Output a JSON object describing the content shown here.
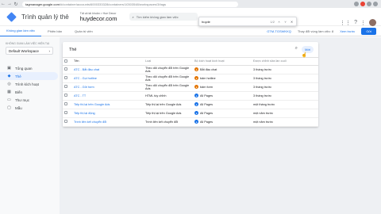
{
  "browser": {
    "host": "tagmanager.google.com",
    "url_rest": "/#/container/accounts/6000333328/containers/10303548/workspaces/3/tags",
    "back": "←",
    "forward": "→",
    "reload": "↻"
  },
  "header": {
    "app_title": "Trình quản lý thẻ",
    "account_small": "Tất cả tài khoản > Hue Decor",
    "container_name": "huydecor.com",
    "search_placeholder": "Tìm kiếm không gian làm việc"
  },
  "find_bar": {
    "query": "huyde",
    "count": "1/2",
    "up": "˄",
    "down": "˅",
    "close": "✕"
  },
  "subnav": {
    "tabs": [
      "Không gian làm việc",
      "Phiên bản",
      "Quản trị viên"
    ],
    "gtm_id": "GTM-TGSWKKQ",
    "changes": "Thay đổi vùng làm việc: 8",
    "preview": "Xem trước",
    "submit": "Gửi"
  },
  "sidebar": {
    "workspace_label": "KHÔNG GIAN LÀM VIỆC HIỆN TẠI",
    "workspace_name": "Default Workspace",
    "items": [
      {
        "label": "Tổng quan",
        "icon": "overview-icon"
      },
      {
        "label": "Thẻ",
        "icon": "tag-icon"
      },
      {
        "label": "Trình kích hoạt",
        "icon": "trigger-icon"
      },
      {
        "label": "Biến",
        "icon": "variable-icon"
      },
      {
        "label": "Thư mục",
        "icon": "folder-icon"
      },
      {
        "label": "Mẫu",
        "icon": "template-icon"
      }
    ],
    "active_index": 1
  },
  "tags_card": {
    "title": "Thẻ",
    "new_label": "Mới",
    "columns": [
      "Tên",
      "Loại",
      "Bộ kích hoạt kích hoạt",
      "Được chỉnh sửa lần cuối"
    ],
    "rows": [
      {
        "name": "ATC - Bắt đầu chat",
        "type": "Theo dõi chuyển đổi trên Google Ads",
        "trigger": "Bắt đầu chat",
        "trigger_color": "orange",
        "time": "3 tháng trước"
      },
      {
        "name": "ATC - Gọi hotline",
        "type": "Theo dõi chuyển đổi trên Google Ads",
        "trigger": "bấm hotline",
        "trigger_color": "orange",
        "time": "3 tháng trước"
      },
      {
        "name": "ATC - Gửi form",
        "type": "Theo dõi chuyển đổi trên Google Ads",
        "trigger": "bấm form",
        "trigger_color": "orange",
        "time": "3 tháng trước"
      },
      {
        "name": "ATC - TT",
        "type": "HTML tùy chỉnh",
        "trigger": "All Pages",
        "trigger_color": "blue",
        "time": "3 tháng trước"
      },
      {
        "name": "Tiếp thị lại trên Google Ads",
        "type": "Tiếp thị lại trên Google Ads",
        "trigger": "All Pages",
        "trigger_color": "blue",
        "time": "một tháng trước"
      },
      {
        "name": "Tiếp thị lại động",
        "type": "Tiếp thị lại trên Google Ads",
        "trigger": "All Pages",
        "trigger_color": "blue",
        "time": "một năm trước"
      },
      {
        "name": "Trình liên kết chuyển đổi",
        "type": "Trình liên kết chuyển đổi",
        "trigger": "All Pages",
        "trigger_color": "blue",
        "time": "một năm trước"
      }
    ]
  }
}
